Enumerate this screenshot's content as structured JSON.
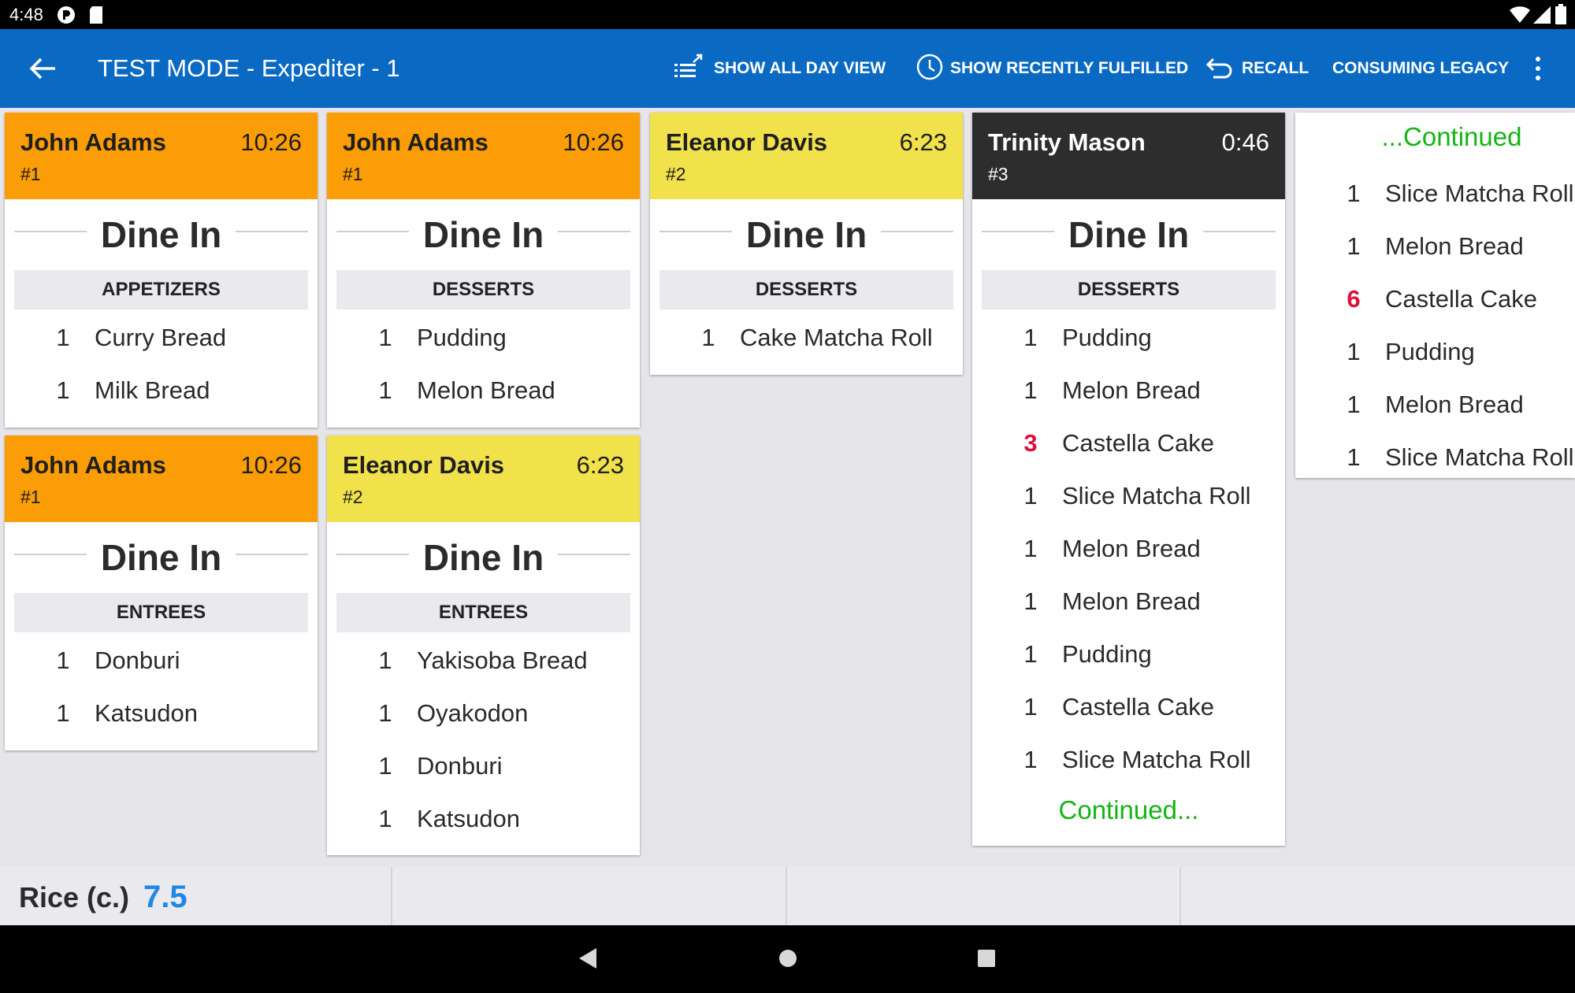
{
  "status_bar": {
    "time": "4:48"
  },
  "app_bar": {
    "title": "TEST MODE - Expediter - 1",
    "actions": {
      "all_day": "SHOW ALL DAY VIEW",
      "recently_fulfilled": "SHOW RECENTLY FULFILLED",
      "recall": "RECALL",
      "consuming_legacy": "CONSUMING LEGACY"
    }
  },
  "colors": {
    "orange": "#fa9d06",
    "yellow": "#f1e14a",
    "dark": "#2d2d2d",
    "appbar": "#0a6ac3",
    "continued": "#14b414",
    "hot_qty": "#e0103c"
  },
  "tickets": [
    {
      "name": "John Adams",
      "time": "10:26",
      "number": "#1",
      "order_type": "Dine In",
      "section": "APPETIZERS",
      "items": [
        {
          "qty": "1",
          "name": "Curry Bread"
        },
        {
          "qty": "1",
          "name": "Milk Bread"
        }
      ]
    },
    {
      "name": "John Adams",
      "time": "10:26",
      "number": "#1",
      "order_type": "Dine In",
      "section": "ENTREES",
      "items": [
        {
          "qty": "1",
          "name": "Donburi"
        },
        {
          "qty": "1",
          "name": "Katsudon"
        }
      ]
    },
    {
      "name": "John Adams",
      "time": "10:26",
      "number": "#1",
      "order_type": "Dine In",
      "section": "DESSERTS",
      "items": [
        {
          "qty": "1",
          "name": "Pudding"
        },
        {
          "qty": "1",
          "name": "Melon Bread"
        }
      ]
    },
    {
      "name": "Eleanor Davis",
      "time": "6:23",
      "number": "#2",
      "order_type": "Dine In",
      "section": "ENTREES",
      "items": [
        {
          "qty": "1",
          "name": "Yakisoba Bread"
        },
        {
          "qty": "1",
          "name": "Oyakodon"
        },
        {
          "qty": "1",
          "name": "Donburi"
        },
        {
          "qty": "1",
          "name": "Katsudon"
        }
      ]
    },
    {
      "name": "Eleanor Davis",
      "time": "6:23",
      "number": "#2",
      "order_type": "Dine In",
      "section": "DESSERTS",
      "items": [
        {
          "qty": "1",
          "name": "Cake Matcha Roll"
        }
      ]
    },
    {
      "name": "Trinity Mason",
      "time": "0:46",
      "number": "#3",
      "order_type": "Dine In",
      "section": "DESSERTS",
      "items": [
        {
          "qty": "1",
          "name": "Pudding"
        },
        {
          "qty": "1",
          "name": "Melon Bread"
        },
        {
          "qty": "3",
          "name": "Castella Cake"
        },
        {
          "qty": "1",
          "name": "Slice Matcha Roll"
        },
        {
          "qty": "1",
          "name": "Melon Bread"
        },
        {
          "qty": "1",
          "name": "Melon Bread"
        },
        {
          "qty": "1",
          "name": "Pudding"
        },
        {
          "qty": "1",
          "name": "Castella Cake"
        },
        {
          "qty": "1",
          "name": "Slice Matcha Roll"
        }
      ],
      "continued": "Continued..."
    },
    {
      "continued_header": "...Continued",
      "items": [
        {
          "qty": "1",
          "name": "Slice Matcha Roll"
        },
        {
          "qty": "1",
          "name": "Melon Bread"
        },
        {
          "qty": "6",
          "name": "Castella Cake"
        },
        {
          "qty": "1",
          "name": "Pudding"
        },
        {
          "qty": "1",
          "name": "Melon Bread"
        },
        {
          "qty": "1",
          "name": "Slice Matcha Roll"
        }
      ]
    }
  ],
  "bottom_bar": {
    "label": "Rice (c.)",
    "value": "7.5"
  }
}
